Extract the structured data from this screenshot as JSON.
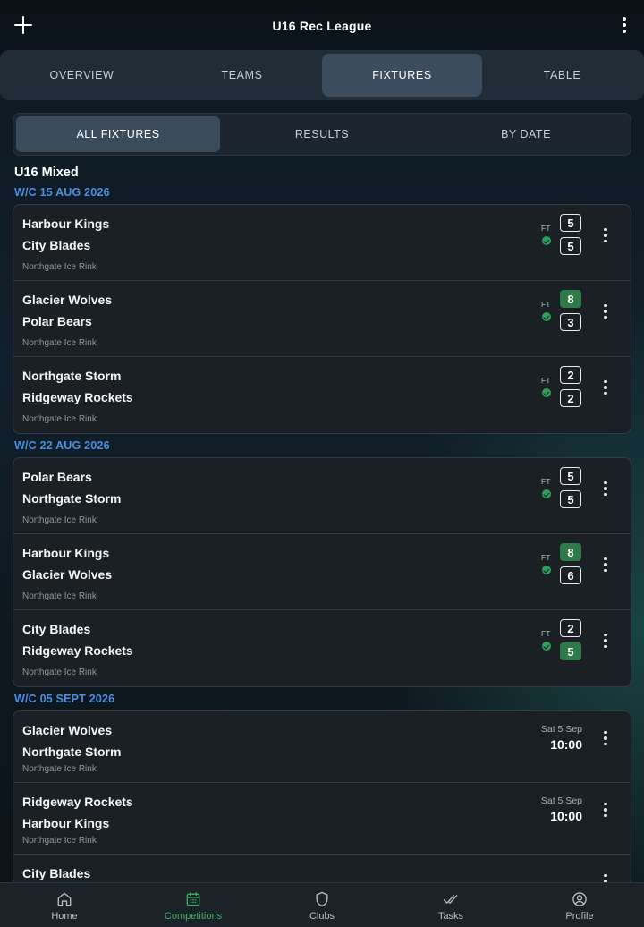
{
  "header": {
    "title": "U16 Rec League"
  },
  "main_tabs": [
    "OVERVIEW",
    "TEAMS",
    "FIXTURES",
    "TABLE"
  ],
  "sub_tabs": [
    "ALL FIXTURES",
    "RESULTS",
    "BY DATE"
  ],
  "division": "U16 Mixed",
  "weeks": [
    {
      "label": "W/C 15 AUG 2026",
      "fixtures": [
        {
          "home": "Harbour Kings",
          "away": "City Blades",
          "venue": "Northgate Ice Rink",
          "status": "FT",
          "home_score": "5",
          "away_score": "5",
          "winner": "none"
        },
        {
          "home": "Glacier Wolves",
          "away": "Polar Bears",
          "venue": "Northgate Ice Rink",
          "status": "FT",
          "home_score": "8",
          "away_score": "3",
          "winner": "home"
        },
        {
          "home": "Northgate Storm",
          "away": "Ridgeway Rockets",
          "venue": "Northgate Ice Rink",
          "status": "FT",
          "home_score": "2",
          "away_score": "2",
          "winner": "none"
        }
      ]
    },
    {
      "label": "W/C 22 AUG 2026",
      "fixtures": [
        {
          "home": "Polar Bears",
          "away": "Northgate Storm",
          "venue": "Northgate Ice Rink",
          "status": "FT",
          "home_score": "5",
          "away_score": "5",
          "winner": "none"
        },
        {
          "home": "Harbour Kings",
          "away": "Glacier Wolves",
          "venue": "Northgate Ice Rink",
          "status": "FT",
          "home_score": "8",
          "away_score": "6",
          "winner": "home"
        },
        {
          "home": "City Blades",
          "away": "Ridgeway Rockets",
          "venue": "Northgate Ice Rink",
          "status": "FT",
          "home_score": "2",
          "away_score": "5",
          "winner": "away"
        }
      ]
    },
    {
      "label": "W/C 05 SEPT 2026",
      "fixtures": [
        {
          "home": "Glacier Wolves",
          "away": "Northgate Storm",
          "venue": "Northgate Ice Rink",
          "date": "Sat 5 Sep",
          "time": "10:00"
        },
        {
          "home": "Ridgeway Rockets",
          "away": "Harbour Kings",
          "venue": "Northgate Ice Rink",
          "date": "Sat 5 Sep",
          "time": "10:00"
        },
        {
          "home": "City Blades",
          "away": "",
          "venue": "",
          "date": "",
          "time": ""
        }
      ]
    }
  ],
  "bottom_nav": [
    {
      "label": "Home",
      "icon": "home-icon"
    },
    {
      "label": "Competitions",
      "icon": "calendar-icon"
    },
    {
      "label": "Clubs",
      "icon": "shield-icon"
    },
    {
      "label": "Tasks",
      "icon": "double-check-icon"
    },
    {
      "label": "Profile",
      "icon": "user-circle-icon"
    }
  ],
  "colors": {
    "accent_green": "#3fae6a",
    "week_blue": "#4a8fe0",
    "win_green": "#2f7a49"
  }
}
